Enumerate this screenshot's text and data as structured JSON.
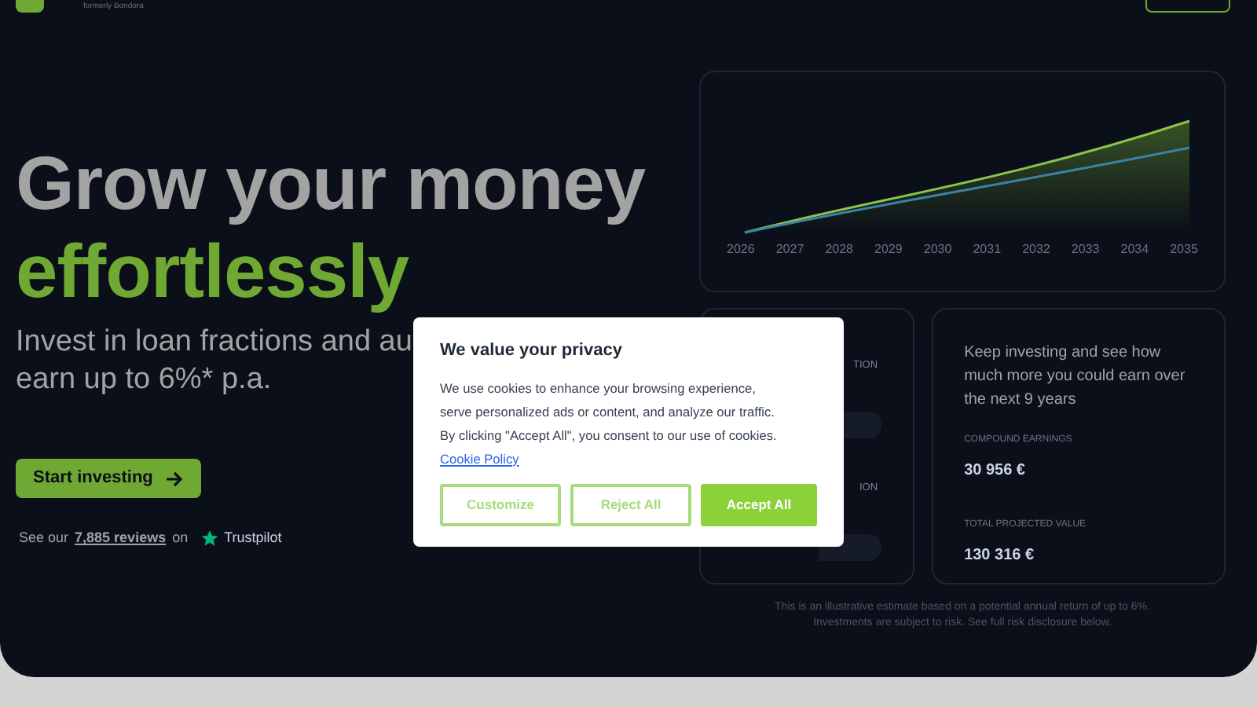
{
  "header": {
    "tagline": "formerly Bondora"
  },
  "hero": {
    "title": "Grow your money",
    "title_highlight": "effortlessly",
    "subtitle_lines": [
      "Invest in loan fractions and au",
      "earn up to 6%* p.a."
    ],
    "cta": "Start investing",
    "reviews": {
      "prefix": "See our",
      "link": "7,885 reviews",
      "middle": "on",
      "brand": "Trustpilot"
    }
  },
  "chart": {
    "x_labels": [
      "2026",
      "2027",
      "2028",
      "2029",
      "2030",
      "2031",
      "2032",
      "2033",
      "2034",
      "2035"
    ]
  },
  "calculator_card": {
    "labels": [
      "TION",
      "ION"
    ]
  },
  "summary_card": {
    "text": "Keep investing and see how much more you could earn over the next 9 years",
    "stats": [
      {
        "label": "COMPOUND EARNINGS",
        "value": "30 956 €"
      },
      {
        "label": "TOTAL PROJECTED VALUE",
        "value": "130 316 €"
      }
    ]
  },
  "disclaimer": "This is an illustrative estimate based on a potential annual return of up to 6%. Investments are subject to risk. See full risk disclosure below.",
  "cookie_dialog": {
    "title": "We value your privacy",
    "body": "We use cookies to enhance your browsing experience, serve personalized ads or content, and analyze our traffic. By clicking \"Accept All\", you consent to our use of cookies.",
    "link": "Cookie Policy",
    "buttons": [
      {
        "label": "Customize",
        "kind": "outline"
      },
      {
        "label": "Reject All",
        "kind": "outline"
      },
      {
        "label": "Accept All",
        "kind": "primary"
      }
    ]
  }
}
